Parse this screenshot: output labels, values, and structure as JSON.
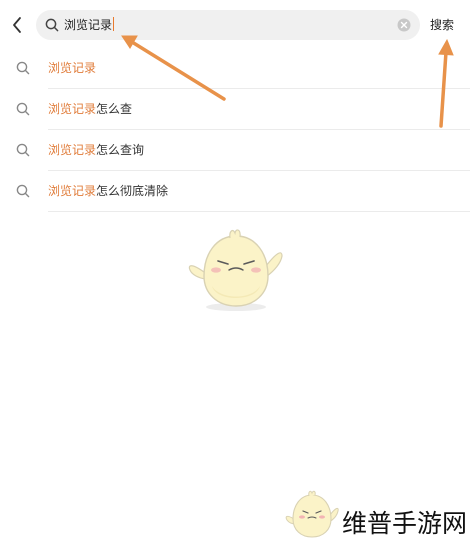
{
  "header": {
    "back_icon": "chevron-left-icon",
    "search_value": "浏览记录",
    "search_icon": "search-icon",
    "clear_icon": "clear-circle-icon",
    "search_button_label": "搜索"
  },
  "suggestions": [
    {
      "highlight": "浏览记录",
      "rest": ""
    },
    {
      "highlight": "浏览记录",
      "rest": "怎么查"
    },
    {
      "highlight": "浏览记录",
      "rest": "怎么查询"
    },
    {
      "highlight": "浏览记录",
      "rest": "怎么彻底清除"
    }
  ],
  "watermark": "维普手游网",
  "colors": {
    "highlight": "#e07c3a",
    "annotation_arrow": "#e8924a",
    "search_bg": "#f0f0f0"
  }
}
